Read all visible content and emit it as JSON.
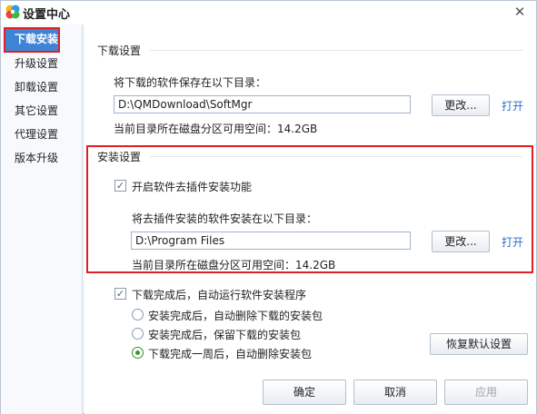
{
  "window": {
    "title": "设置中心",
    "close_glyph": "✕",
    "logo_icon": "qq-pinwheel-logo"
  },
  "sidebar": {
    "items": [
      {
        "label": "下载安装",
        "active": true
      },
      {
        "label": "升级设置",
        "active": false
      },
      {
        "label": "卸载设置",
        "active": false
      },
      {
        "label": "其它设置",
        "active": false
      },
      {
        "label": "代理设置",
        "active": false
      },
      {
        "label": "版本升级",
        "active": false
      }
    ]
  },
  "download": {
    "section_title": "下载设置",
    "save_dir_label": "将下载的软件保存在以下目录：",
    "save_dir_value": "D:\\QMDownload\\SoftMgr",
    "change_label": "更改...",
    "open_label": "打开",
    "free_space": "当前目录所在磁盘分区可用空间：14.2GB"
  },
  "install": {
    "section_title": "安装设置",
    "plugin_checkbox_label": "开启软件去插件安装功能",
    "plugin_checked": true,
    "install_dir_label": "将去插件安装的软件安装在以下目录：",
    "install_dir_value": "D:\\Program Files",
    "change_label": "更改...",
    "open_label": "打开",
    "free_space": "当前目录所在磁盘分区可用空间：14.2GB"
  },
  "after_download": {
    "auto_run_label": "下载完成后，自动运行软件安装程序",
    "auto_run_checked": true,
    "options": [
      {
        "label": "安装完成后，自动删除下载的安装包",
        "selected": false
      },
      {
        "label": "安装完成后，保留下载的安装包",
        "selected": false
      },
      {
        "label": "下载完成一周后，自动删除安装包",
        "selected": true
      }
    ],
    "restore_label": "恢复默认设置"
  },
  "footer": {
    "ok_label": "确定",
    "cancel_label": "取消",
    "apply_label": "应用"
  },
  "colors": {
    "accent": "#3f83d7",
    "highlight": "#e02020",
    "link": "#2b6fc4"
  }
}
